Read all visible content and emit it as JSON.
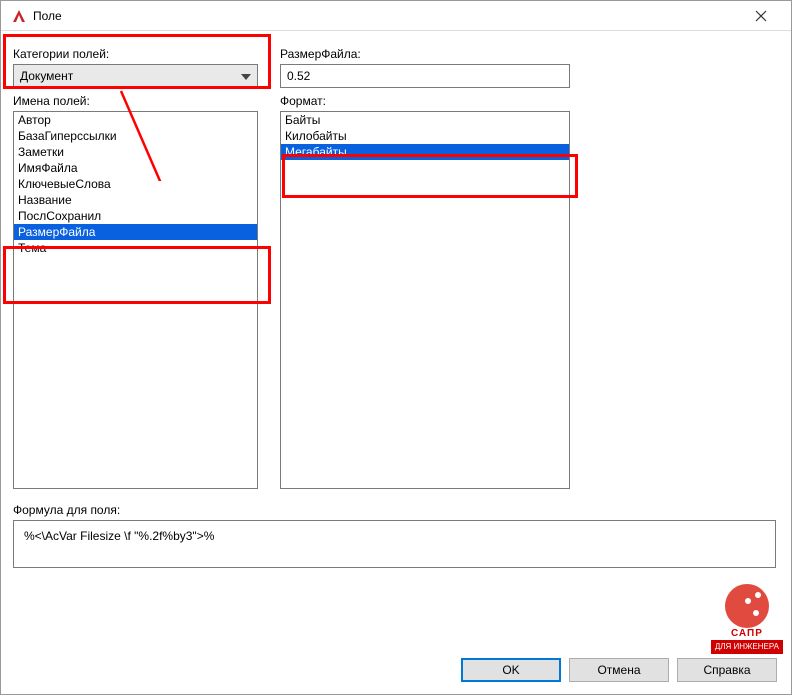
{
  "titlebar": {
    "title": "Поле"
  },
  "left": {
    "category_label": "Категории полей:",
    "category_value": "Документ",
    "names_label": "Имена полей:",
    "names_items": [
      "Автор",
      "БазаГиперссылки",
      "Заметки",
      "ИмяФайла",
      "КлючевыеСлова",
      "Название",
      "ПослСохранил",
      "РазмерФайла",
      "Тема"
    ],
    "names_selected_index": 7
  },
  "right": {
    "size_label": "РазмерФайла:",
    "size_value": "0.52",
    "format_label": "Формат:",
    "format_items": [
      "Байты",
      "Килобайты",
      "Мегабайты"
    ],
    "format_selected_index": 2
  },
  "formula": {
    "label": "Формула для поля:",
    "value": "%<\\AcVar Filesize \\f \"%.2f%by3\">%"
  },
  "buttons": {
    "ok": "OK",
    "cancel": "Отмена",
    "help": "Справка"
  },
  "watermark": {
    "brand": "САПР",
    "sub": "ДЛЯ ИНЖЕНЕРА"
  }
}
